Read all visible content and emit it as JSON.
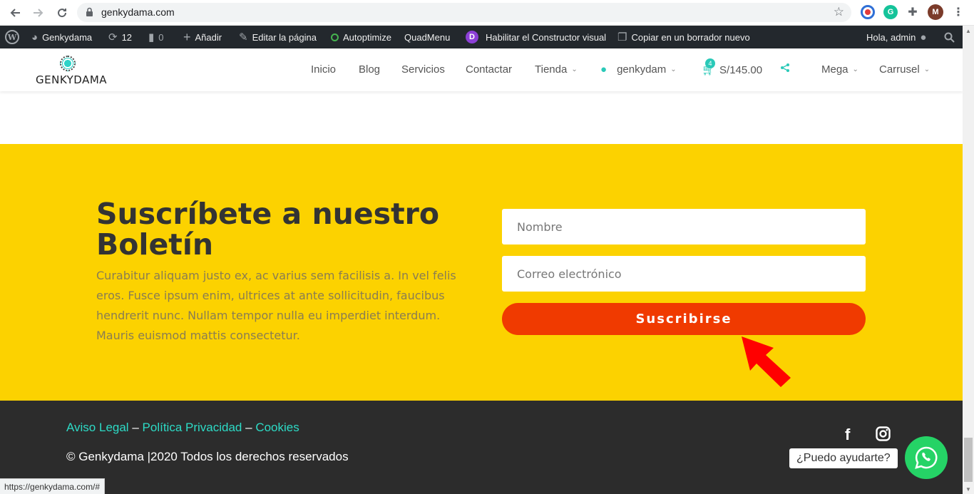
{
  "browser": {
    "url": "genkydama.com",
    "status_url": "https://genkydama.com/#",
    "profile_initial": "M"
  },
  "admin_bar": {
    "site_name": "Genkydama",
    "updates_count": "12",
    "comments_count": "0",
    "add_new": "Añadir",
    "edit_page": "Editar la página",
    "autoptimize": "Autoptimize",
    "quadmenu": "QuadMenu",
    "divi_letter": "D",
    "enable_builder": "Habilitar el Constructor visual",
    "copy_draft": "Copiar en un borrador nuevo",
    "greeting": "Hola, admin"
  },
  "header": {
    "logo_text": "GENKYDAMA",
    "menu": {
      "inicio": "Inicio",
      "blog": "Blog",
      "servicios": "Servicios",
      "contactar": "Contactar",
      "tienda": "Tienda",
      "user": "genkydam",
      "cart_total": "S/145.00",
      "cart_count": "4",
      "mega": "Mega",
      "carrusel": "Carrusel"
    }
  },
  "newsletter": {
    "title": "Suscríbete a nuestro Boletín",
    "text": "Curabitur aliquam justo ex, ac varius sem facilisis a. In vel felis eros. Fusce ipsum enim, ultrices at ante sollicitudin, faucibus hendrerit nunc. Nullam tempor nulla eu imperdiet interdum. Mauris euismod mattis consectetur.",
    "name_placeholder": "Nombre",
    "email_placeholder": "Correo electrónico",
    "submit_label": "Suscribirse"
  },
  "footer": {
    "legal": "Aviso Legal",
    "privacy": "Política Privacidad",
    "cookies": "Cookies",
    "separator": "–",
    "copyright": "© Genkydama |2020 Todos los derechos reservados",
    "chat_prompt": "¿Puedo ayudarte?"
  },
  "colors": {
    "accent": "#2ddbc6",
    "newsletter_bg": "#fcd200",
    "button": "#f03a00",
    "footer_bg": "#2c2c2c",
    "whatsapp": "#25d366",
    "arrow": "#ff0000"
  }
}
